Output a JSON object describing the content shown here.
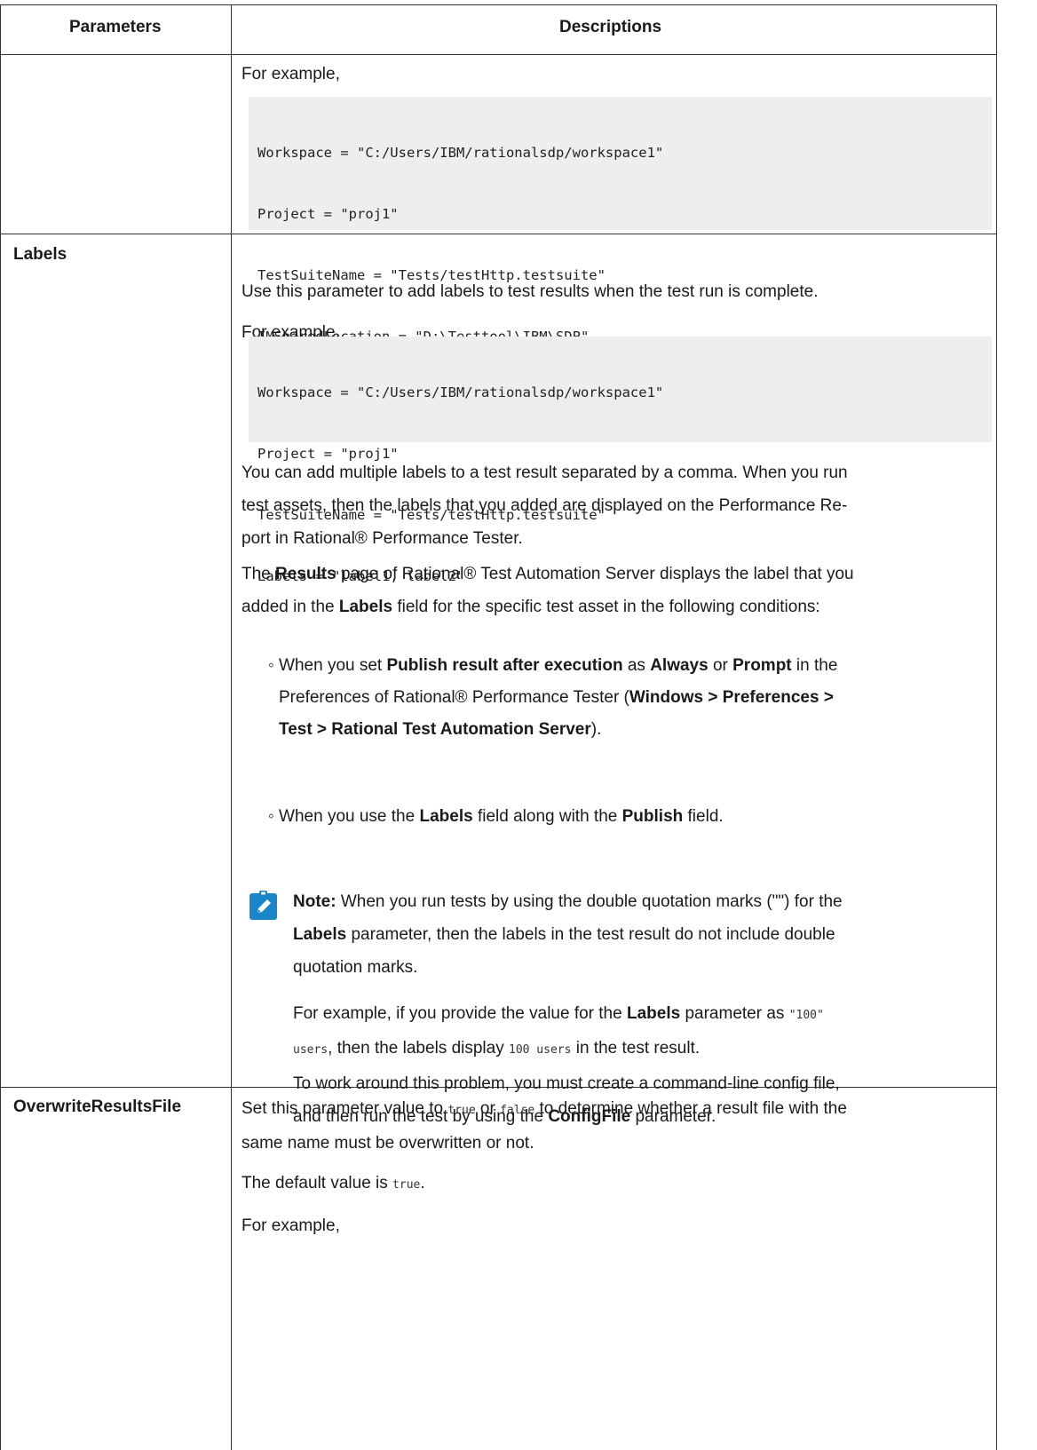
{
  "header": {
    "col1": "Parameters",
    "col2": "Descriptions"
  },
  "row0": {
    "for_example": "For example,",
    "code": [
      "Workspace = \"C:/Users/IBM/rationalsdp/workspace1\"",
      "Project = \"proj1\"",
      "TestSuiteName = \"Tests/testHttp.testsuite\"",
      "IMSharedLocation = \"D:\\Testtool\\IBM\\SDP\""
    ]
  },
  "labels_row": {
    "param": "Labels",
    "intro": "Use this parameter to add labels to test results when the test run is complete.",
    "for_example": "For example,",
    "code": [
      "Workspace = \"C:/Users/IBM/rationalsdp/workspace1\"",
      "Project = \"proj1\"",
      "TestSuiteName = \"Tests/testHttp.testsuite\"",
      "Labels = \"label1, label2\""
    ],
    "multi_line1": "You can add multiple labels to a test result separated by a comma. When you run",
    "multi_line2": "test assets, then the labels that you added are displayed on the Performance Re-",
    "multi_line3": "port in  Rational® Performance Tester.",
    "results_p": {
      "t1": "The ",
      "b1": "Results",
      "t2": " page of Rational® Test Automation Server displays the label that you",
      "t3": "added in the ",
      "b2": "Labels",
      "t4": " field for the specific test asset in the following conditions:"
    },
    "bullet1": {
      "dot": "◦",
      "t1": " When you set ",
      "b1": "Publish result after execution",
      "t2": " as ",
      "b2": "Always",
      "t3": " or ",
      "b3": "Prompt",
      "t4": " in the",
      "t5": "Preferences of  Rational® Performance Tester (",
      "b4": "Windows > Preferences >",
      "b5": "Test > Rational Test Automation Server",
      "t6": ")."
    },
    "bullet2": {
      "dot": "◦",
      "t1": " When you use the ",
      "b1": "Labels",
      "t2": " field along with the ",
      "b2": "Publish",
      "t3": " field."
    },
    "note": {
      "label": "Note:",
      "t1": " When you run tests by using the double quotation marks (\"\") for the",
      "b1": "Labels",
      "t2": " parameter, then the labels in the test result do not include double",
      "t3": "quotation marks.",
      "ex_t1": "For example, if you provide the value for the ",
      "ex_b1": "Labels",
      "ex_t2": " parameter as ",
      "ex_c1": "\"100\"",
      "ex_c2": "users",
      "ex_t3": ", then the labels display ",
      "ex_c3": "100 users",
      "ex_t4": " in the test result.",
      "wa_t1": "To work around this problem, you must create a command-line config file,",
      "wa_t2": "and then run the test by using the ",
      "wa_b1": "ConfigFile",
      "wa_t3": " parameter."
    }
  },
  "overwrite_row": {
    "param": "OverwriteResultsFile",
    "l1_t1": "Set this parameter value to ",
    "l1_c1": "true",
    "l1_t2": " or ",
    "l1_c2": "false",
    "l1_t3": " to determine whether a result file with the",
    "l2": "same name must be overwritten or not.",
    "default_t": "The default value is ",
    "default_c": "true",
    "default_end": ".",
    "for_example": "For example,"
  },
  "colors": {
    "border": "#333333",
    "code_bg": "#eeeeee",
    "note_icon": "#1a85c8"
  },
  "icons": {
    "note": "pencil-note-icon"
  }
}
